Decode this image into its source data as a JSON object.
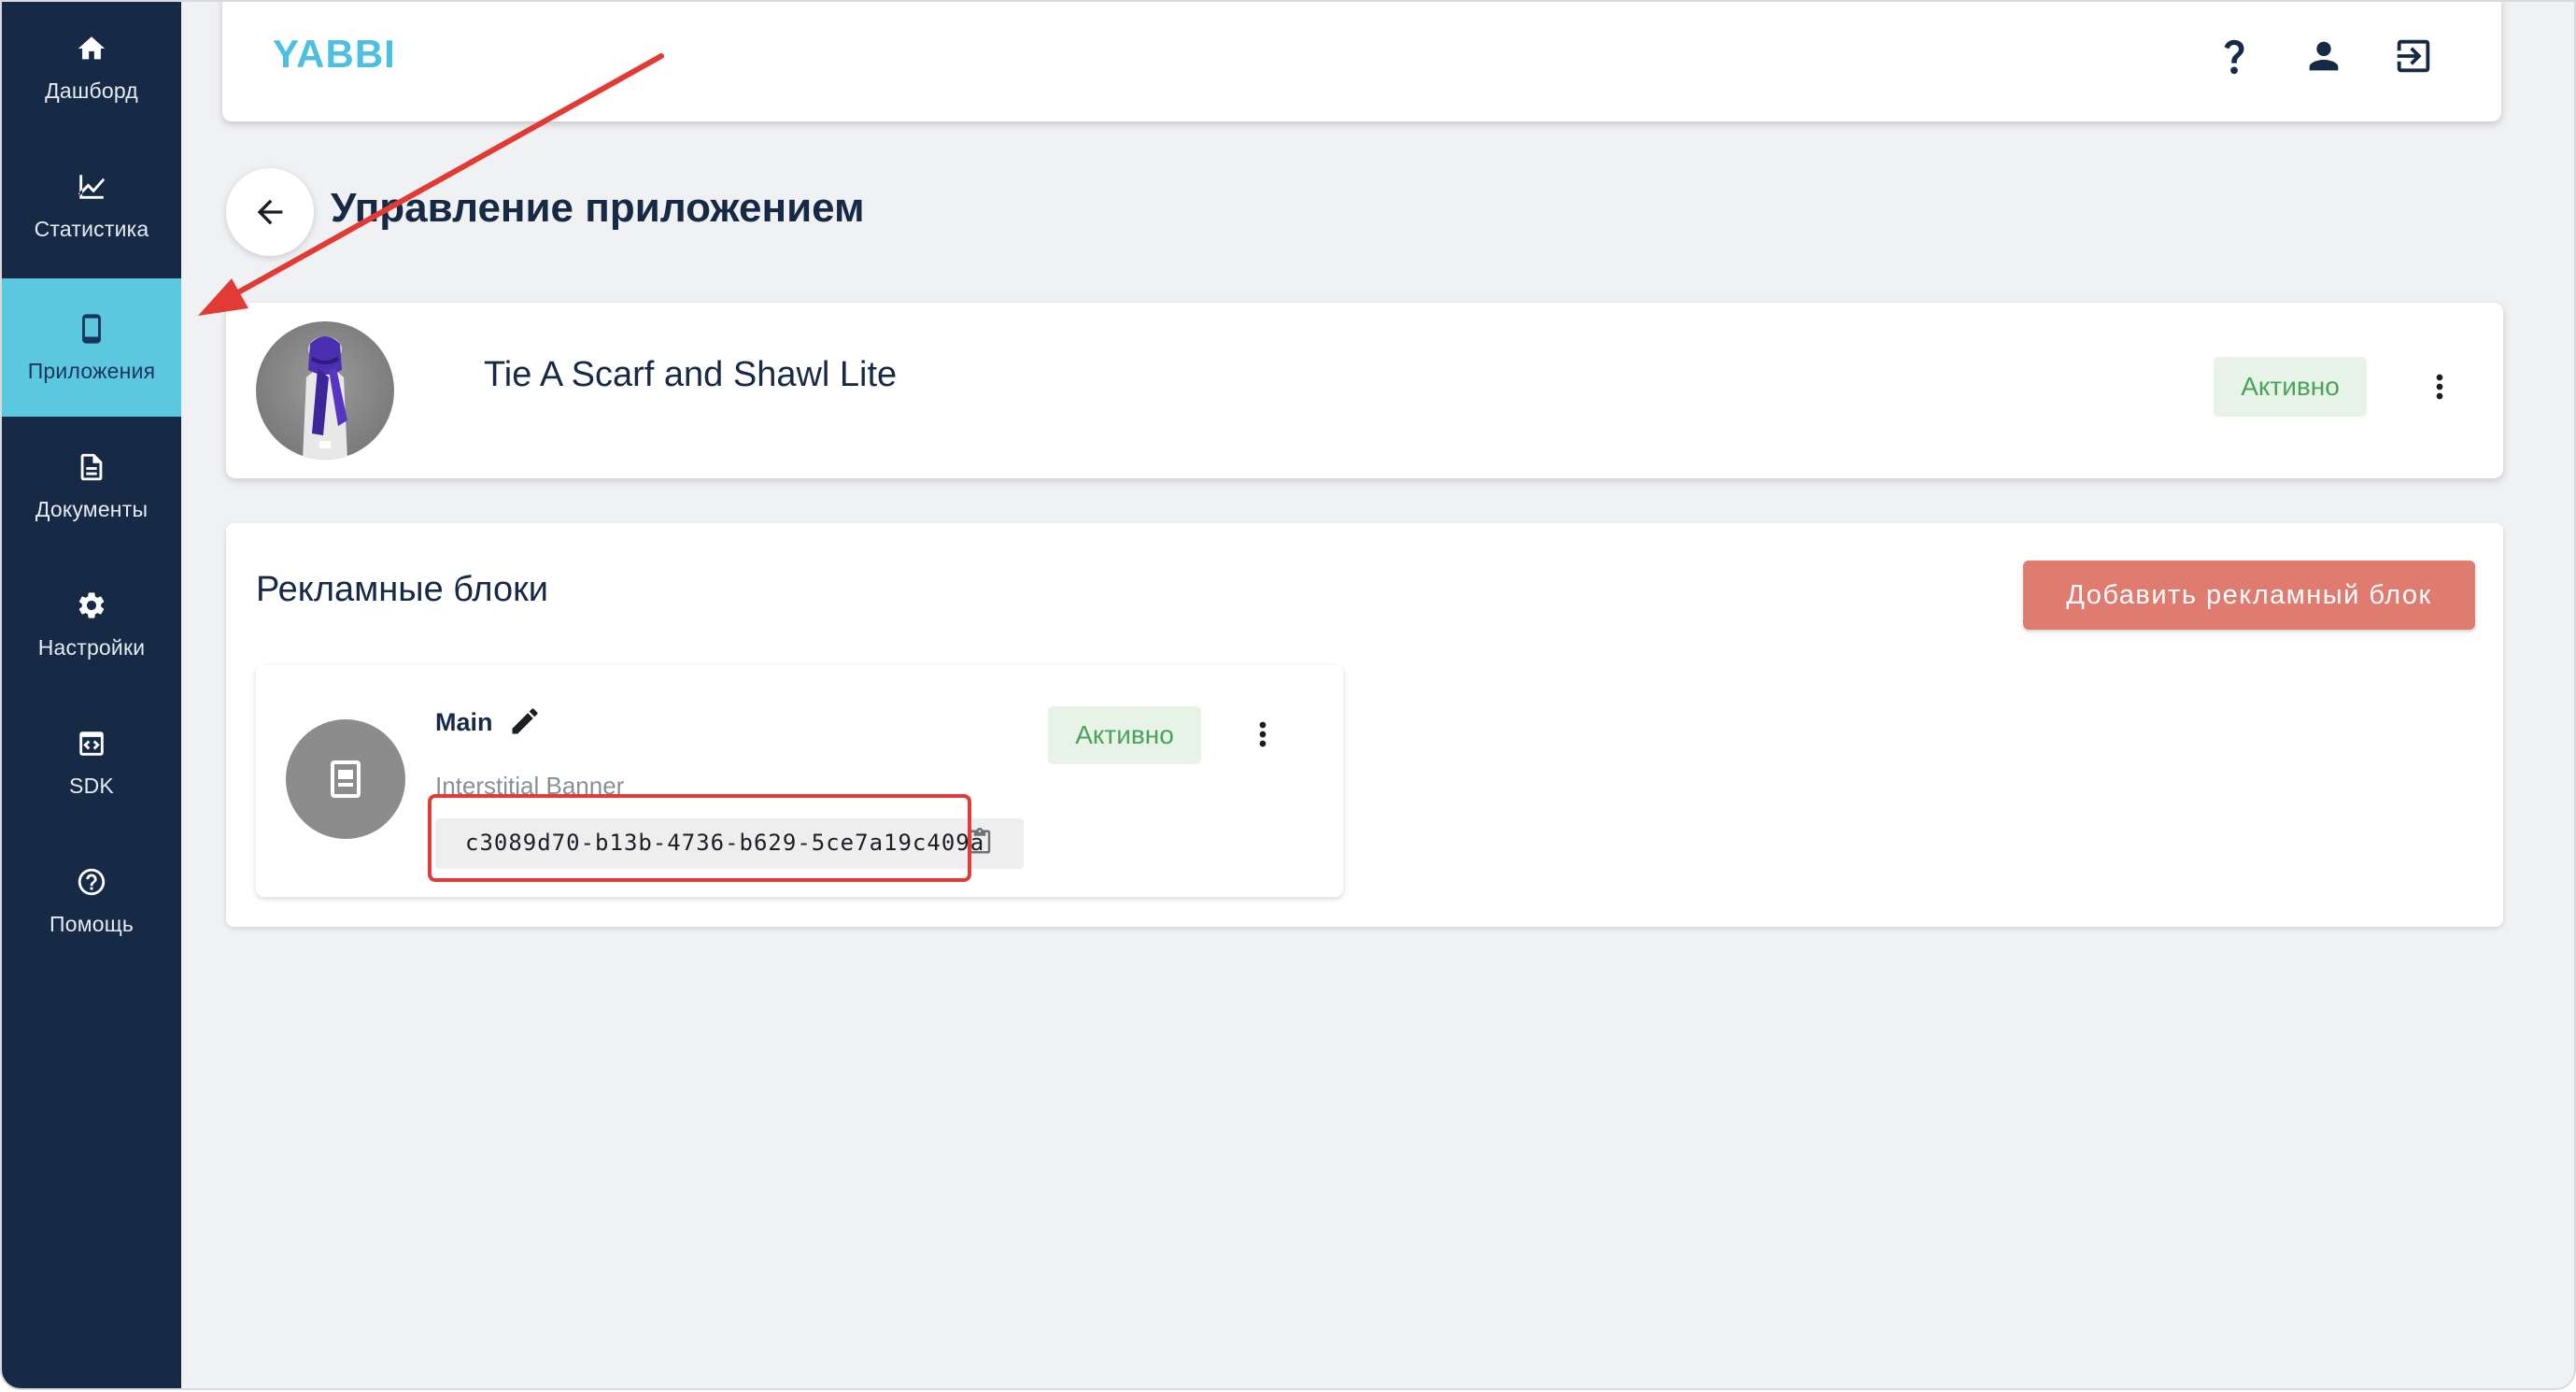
{
  "sidebar": {
    "items": [
      {
        "label": "Дашборд",
        "icon": "home-icon"
      },
      {
        "label": "Статистика",
        "icon": "chart-icon"
      },
      {
        "label": "Приложения",
        "icon": "phone-icon",
        "active": true
      },
      {
        "label": "Документы",
        "icon": "document-icon"
      },
      {
        "label": "Настройки",
        "icon": "gear-icon"
      },
      {
        "label": "SDK",
        "icon": "code-icon"
      },
      {
        "label": "Помощь",
        "icon": "help-icon"
      }
    ]
  },
  "header": {
    "logo": "YABBI",
    "icons": [
      "help-icon",
      "user-icon",
      "logout-icon"
    ]
  },
  "page": {
    "title": "Управление приложением"
  },
  "app": {
    "name": "Tie A Scarf and Shawl Lite",
    "status": "Активно"
  },
  "ad_blocks": {
    "title": "Рекламные блоки",
    "add_button": "Добавить рекламный блок",
    "items": [
      {
        "name": "Main",
        "type": "Interstitial Banner",
        "id": "c3089d70-b13b-4736-b629-5ce7a19c409a",
        "status": "Активно"
      }
    ]
  },
  "colors": {
    "sidebar_bg": "#172a45",
    "sidebar_active": "#5bc8e0",
    "logo": "#4dbfe0",
    "add_button": "#e07b70",
    "status_bg": "#e6f3e6",
    "status_text": "#4aa35a",
    "annotation": "#e23b36"
  }
}
